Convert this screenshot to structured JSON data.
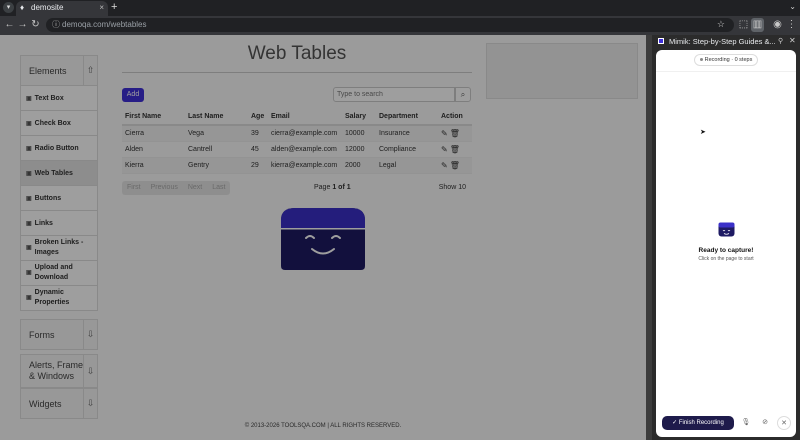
{
  "browser": {
    "tab_title": "demosite",
    "tab_close": "×",
    "new_tab": "+",
    "url_host": "demoqa.com",
    "url_path": "/webtables"
  },
  "page": {
    "title": "Web Tables",
    "sidebar": {
      "groups": [
        {
          "label": "Elements"
        },
        {
          "label": "Forms"
        },
        {
          "label": "Alerts, Frame & Windows"
        },
        {
          "label": "Widgets"
        }
      ],
      "elements_items": [
        "Text Box",
        "Check Box",
        "Radio Button",
        "Web Tables",
        "Buttons",
        "Links",
        "Broken Links - Images",
        "Upload and Download",
        "Dynamic Properties"
      ]
    },
    "add_label": "Add",
    "search_placeholder": "Type to search",
    "table": {
      "headers": [
        "First Name",
        "Last Name",
        "Age",
        "Email",
        "Salary",
        "Department",
        "Action"
      ],
      "rows": [
        [
          "Cierra",
          "Vega",
          "39",
          "cierra@example.com",
          "10000",
          "Insurance"
        ],
        [
          "Alden",
          "Cantrell",
          "45",
          "alden@example.com",
          "12000",
          "Compliance"
        ],
        [
          "Kierra",
          "Gentry",
          "29",
          "kierra@example.com",
          "2000",
          "Legal"
        ]
      ]
    },
    "pagination": {
      "first": "First",
      "previous": "Previous",
      "next": "Next",
      "last": "Last",
      "page_prefix": "Page",
      "page_current": "1",
      "page_of": "of",
      "page_total": "1",
      "show": "Show 10"
    },
    "footer": "© 2013-2026 TOOLSQA.COM | ALL RIGHTS RESERVED."
  },
  "extension": {
    "title": "Mimik: Step-by-Step Guides &...",
    "recording_status": "Recording · 0 steps",
    "ready_title": "Ready to capture!",
    "ready_subtitle": "Click on the page to start",
    "finish_label": "Finish Recording",
    "brand_color": "#3f2fd9"
  }
}
